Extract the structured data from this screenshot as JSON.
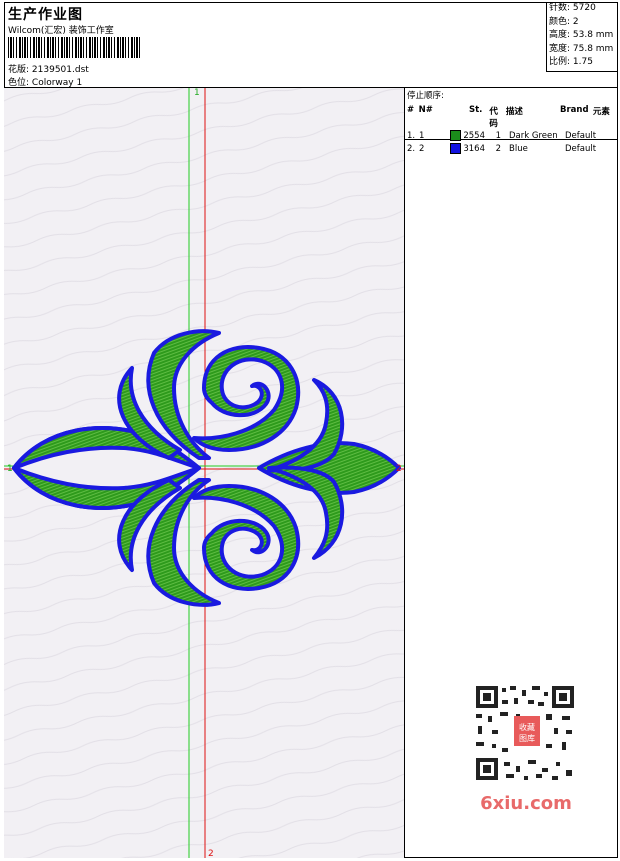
{
  "header": {
    "title": "生产作业图",
    "company": "Wilcom(汇宏) 装饰工作室",
    "design_label": "花版:",
    "design_file": "2139501.dst",
    "colorway_label": "色位:",
    "colorway": "Colorway 1"
  },
  "stats": {
    "stitches": "针数: 5720",
    "colors": "颜色: 2",
    "height": "高度: 53.8 mm",
    "width": "宽度: 75.8 mm",
    "ratio": "比例: 1.75"
  },
  "stop_sequence": {
    "title": "停止顺序:",
    "columns": [
      "#",
      "N#",
      "St.",
      "代码",
      "描述",
      "Brand",
      "元素"
    ],
    "rows": [
      {
        "index": "1.",
        "num": "1",
        "st": "2554",
        "code": "1",
        "desc": "Dark Green",
        "brand": "Default",
        "color": "#1b8c1b"
      },
      {
        "index": "2.",
        "num": "2",
        "st": "3164",
        "code": "2",
        "desc": "Blue",
        "brand": "Default",
        "color": "#1212e0"
      }
    ]
  },
  "markers": {
    "top": "1",
    "bottom": "2",
    "left": "1",
    "right": "2"
  },
  "colors": {
    "thread_green": "#2e9a1c",
    "thread_blue": "#1a1ae0",
    "guide_green": "#22cc22",
    "guide_red": "#dd1111",
    "canvas_bg": "#f2f0f4"
  },
  "watermark": {
    "text": "6xiu.com",
    "stamp": "收藏图库"
  }
}
